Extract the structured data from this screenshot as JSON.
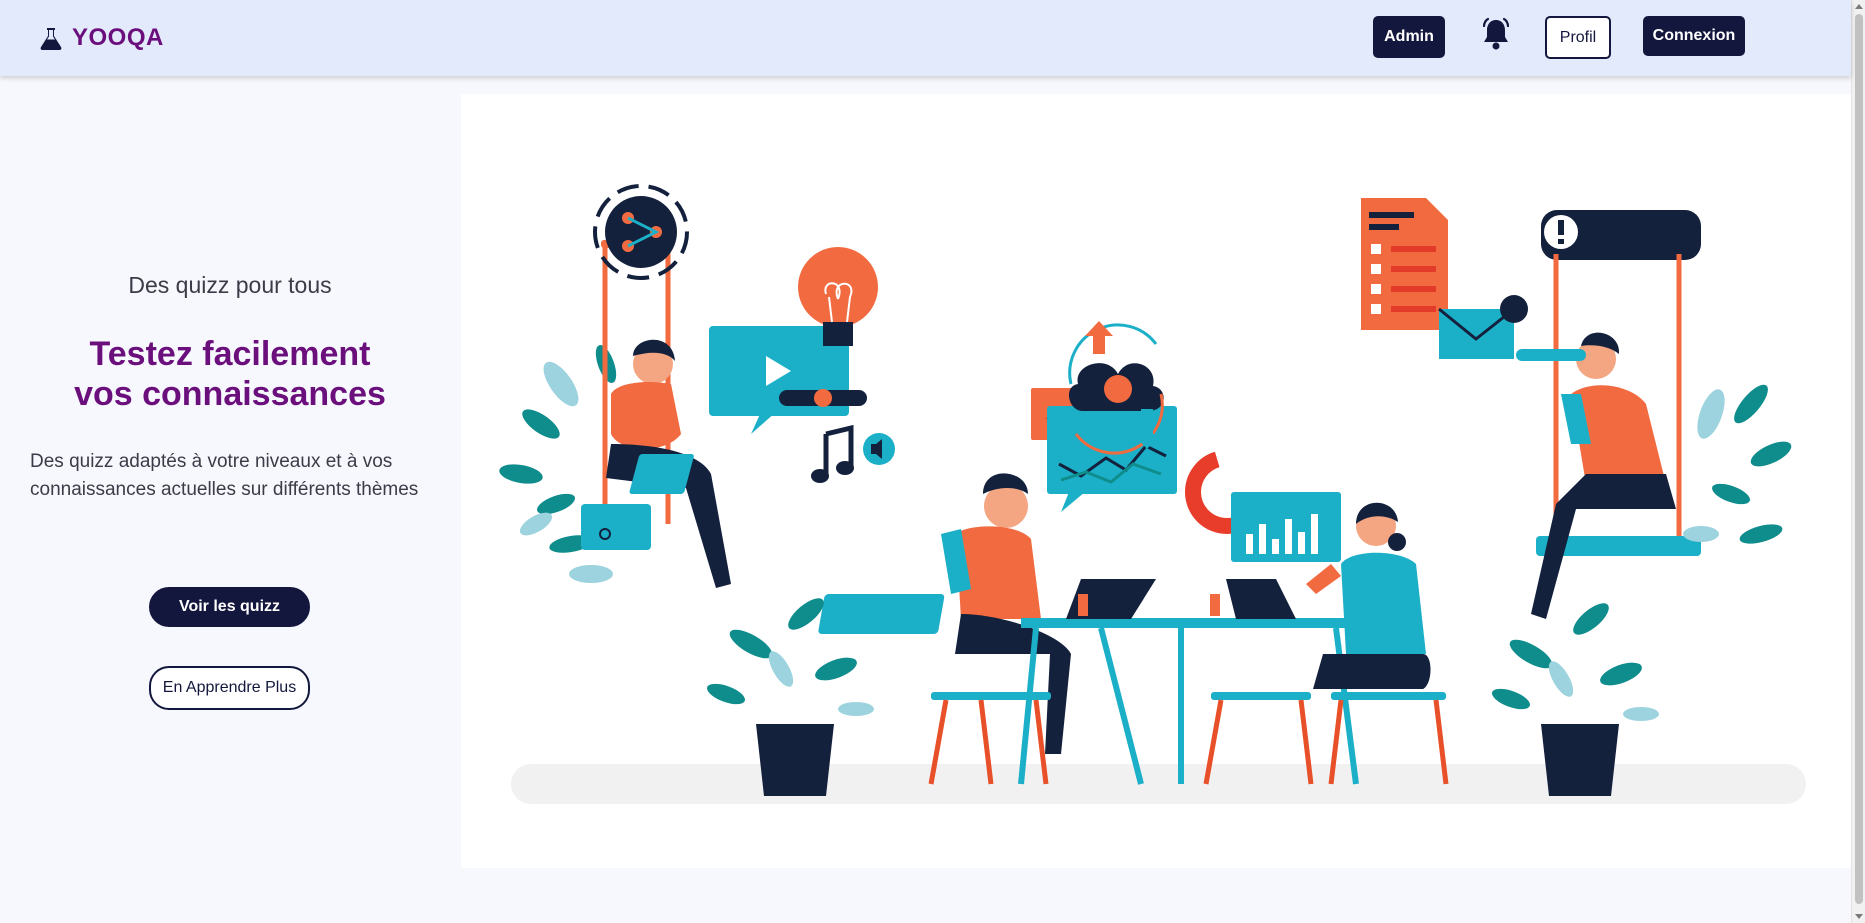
{
  "app": {
    "brand": "YOOQA",
    "brand_color": "#6b0f7c",
    "accent_dark": "#14173d",
    "nav_bg": "#e3eafb"
  },
  "nav": {
    "admin_label": "Admin",
    "bell_icon": "bell-icon",
    "profil_label": "Profil",
    "connexion_label": "Connexion"
  },
  "hero": {
    "subtitle": "Des quizz pour tous",
    "title_line1": "Testez facilement",
    "title_line2": "vos connaissances",
    "description": "Des quizz adaptés à votre niveaux et à vos connaissances actuelles sur différents thèmes",
    "primary_button": "Voir les quizz",
    "secondary_button": "En Apprendre Plus"
  },
  "illustration": {
    "icon": "team-collaboration-illustration",
    "colors": [
      "#f26a3f",
      "#1bb0c8",
      "#14213d",
      "#0f8c8c"
    ]
  }
}
